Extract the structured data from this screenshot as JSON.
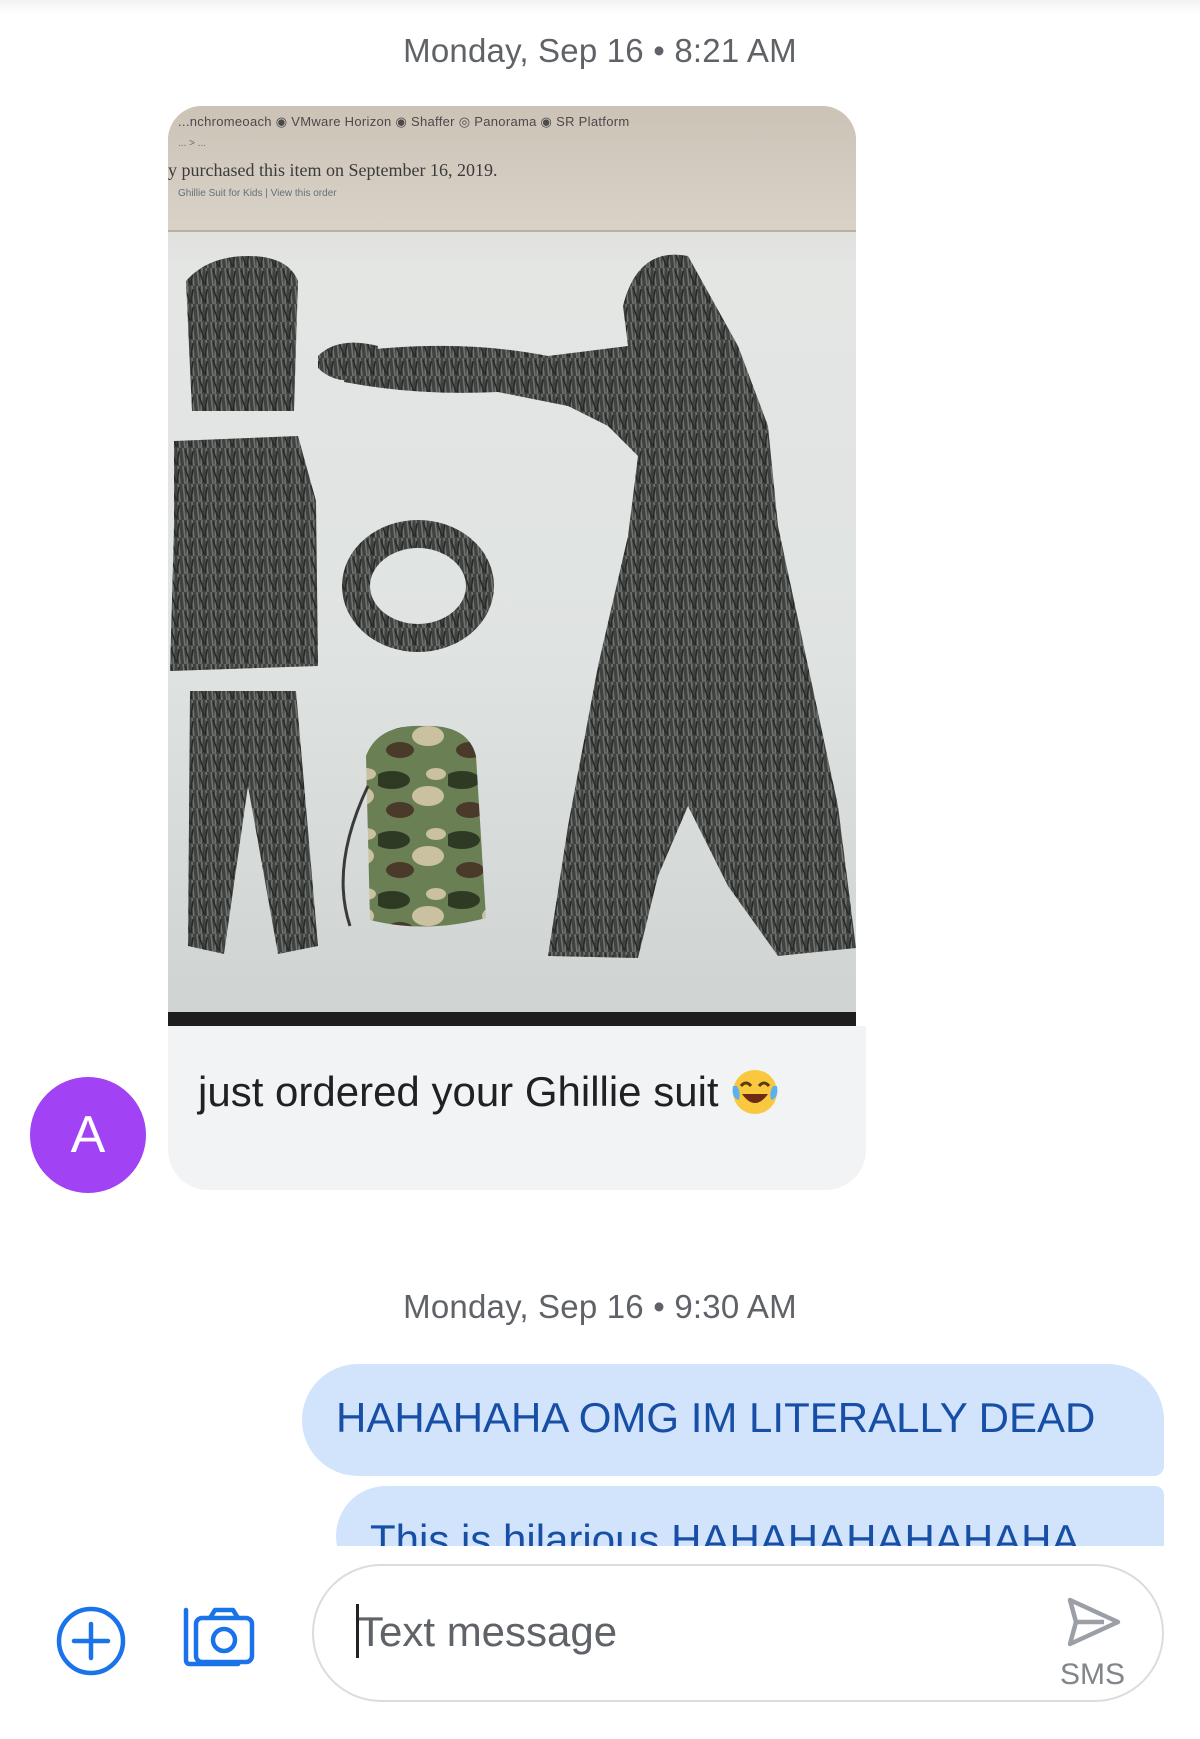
{
  "conversation": {
    "timestamp_1": "Monday, Sep 16 • 8:21 AM",
    "timestamp_2": "Monday, Sep 16 • 9:30 AM",
    "incoming_message": {
      "sender_initial": "A",
      "text": "just ordered your Ghillie suit",
      "emoji": "face-with-tears-of-joy",
      "image": {
        "browser_tabs": "...nchromeoach  ◉ VMware Horizon  ◉ Shaffer  ◎ Panorama  ◉ SR Platform",
        "breadcrumbs": "... > ...",
        "purchased_text": "y purchased this item on September 16, 2019.",
        "links": "Ghillie Suit for Kids | View this order"
      }
    },
    "outgoing_messages": [
      "HAHAHAHA OMG IM LITERALLY DEAD",
      "This is hilarious HAHAHAHAHAHAHA"
    ]
  },
  "compose": {
    "placeholder": "Text message",
    "send_label": "SMS"
  },
  "colors": {
    "avatar": "#a142f4",
    "outgoing_bubble": "#d2e3fc",
    "outgoing_text": "#174ea6",
    "incoming_bubble": "#f1f3f4",
    "icon_accent": "#1a73e8"
  },
  "icons": [
    "add-attachment-icon",
    "camera-icon",
    "send-icon",
    "laughing-emoji-icon"
  ]
}
